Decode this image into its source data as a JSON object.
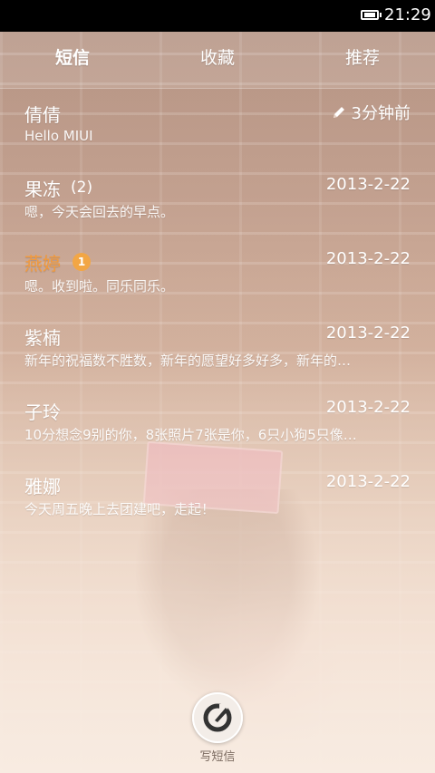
{
  "status_bar": {
    "time": "21:29"
  },
  "tabs": [
    {
      "label": "短信"
    },
    {
      "label": "收藏"
    },
    {
      "label": "推荐"
    }
  ],
  "conversations": [
    {
      "name": "倩倩",
      "count": "",
      "time": "3分钟前",
      "preview": "Hello MIUI",
      "draft_icon": "pencil-icon"
    },
    {
      "name": "果冻",
      "count": "(2)",
      "time": "2013-2-22",
      "preview": "嗯，今天会回去的早点。"
    },
    {
      "name": "燕婷",
      "count": "",
      "badge": "1",
      "time": "2013-2-22",
      "preview": "嗯。收到啦。同乐同乐。",
      "unread": true,
      "accent": "#f39a3b"
    },
    {
      "name": "紫楠",
      "count": "",
      "time": "2013-2-22",
      "preview": "新年的祝福数不胜数，新年的愿望好多好多，新年的…"
    },
    {
      "name": "子玲",
      "count": "",
      "time": "2013-2-22",
      "preview": "10分想念9别的你，8张照片7张是你，6只小狗5只像…"
    },
    {
      "name": "雅娜",
      "count": "",
      "time": "2013-2-22",
      "preview": "今天周五晚上去团建吧，走起！"
    }
  ],
  "compose": {
    "label": "写短信",
    "icon": "compose-icon"
  }
}
